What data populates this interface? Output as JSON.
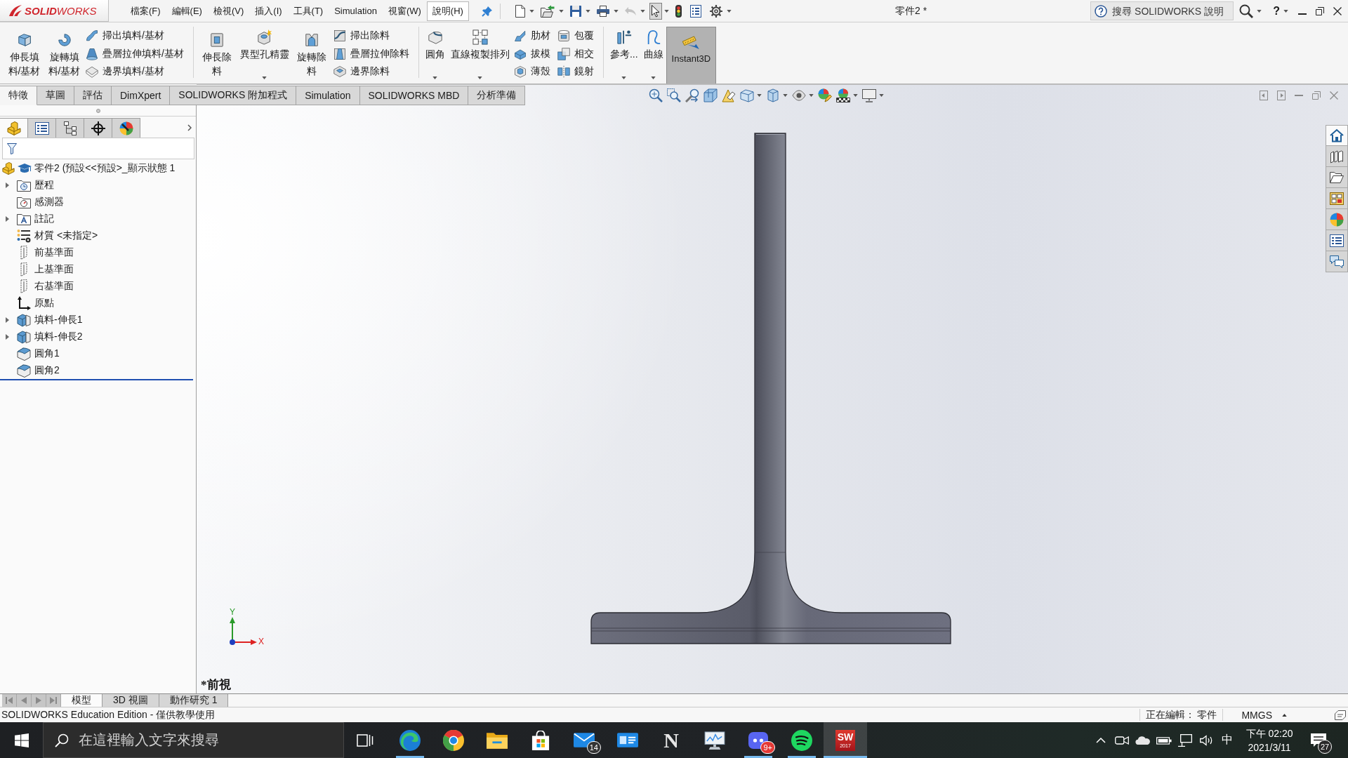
{
  "title_bar": {
    "logo": "**SOLID**WORKS",
    "menu": [
      {
        "label": "檔案(F)",
        "selected": false
      },
      {
        "label": "編輯(E)",
        "selected": false
      },
      {
        "label": "檢視(V)",
        "selected": false
      },
      {
        "label": "插入(I)",
        "selected": false
      },
      {
        "label": "工具(T)",
        "selected": false
      },
      {
        "label": "Simulation",
        "selected": false
      },
      {
        "label": "視窗(W)",
        "selected": false
      },
      {
        "label": "說明(H)",
        "selected": true
      }
    ],
    "quick_access": [
      {
        "kind": "new",
        "dropdown": true,
        "disabled": false,
        "selected": false
      },
      {
        "kind": "open",
        "dropdown": true,
        "disabled": false,
        "selected": false
      },
      {
        "kind": "save",
        "dropdown": true,
        "disabled": false,
        "selected": false
      },
      {
        "kind": "print",
        "dropdown": true,
        "disabled": false,
        "selected": false
      },
      {
        "kind": "undo",
        "dropdown": true,
        "disabled": true,
        "selected": false
      },
      {
        "kind": "select",
        "dropdown": true,
        "disabled": false,
        "selected": true
      },
      {
        "kind": "rebuild",
        "dropdown": false,
        "disabled": false,
        "selected": false
      },
      {
        "kind": "properties",
        "dropdown": false,
        "disabled": false,
        "selected": false
      },
      {
        "kind": "options",
        "dropdown": true,
        "disabled": false,
        "selected": false
      }
    ],
    "document_title": "零件2 *",
    "search": {
      "placeholder": "搜尋 SOLIDWORKS 說明"
    },
    "help": "?"
  },
  "ribbon": {
    "groups": [
      {
        "items": [
          {
            "kind": "large",
            "label": "伸長填料/基材",
            "dropdown": false,
            "pressed": false
          },
          {
            "kind": "large",
            "label": "旋轉填料/基材",
            "dropdown": false,
            "pressed": false
          },
          {
            "kind": "stack",
            "items": [
              {
                "label": "掃出填料/基材"
              },
              {
                "label": "疊層拉伸填料/基材"
              },
              {
                "label": "邊界填料/基材"
              }
            ]
          }
        ]
      },
      {
        "items": [
          {
            "kind": "large",
            "label": "伸長除料",
            "dropdown": false,
            "pressed": false
          },
          {
            "kind": "large",
            "label": "異型孔精靈",
            "dropdown": true,
            "pressed": false
          },
          {
            "kind": "large",
            "label": "旋轉除料",
            "dropdown": false,
            "pressed": false
          },
          {
            "kind": "stack",
            "items": [
              {
                "label": "掃出除料"
              },
              {
                "label": "疊層拉伸除料"
              },
              {
                "label": "邊界除料"
              }
            ]
          }
        ]
      },
      {
        "items": [
          {
            "kind": "large",
            "label": "圓角",
            "dropdown": true,
            "pressed": false
          },
          {
            "kind": "large",
            "label": "直線複製排列",
            "dropdown": true,
            "pressed": false
          },
          {
            "kind": "stack",
            "items": [
              {
                "label": "肋材"
              },
              {
                "label": "拔模"
              },
              {
                "label": "薄殼"
              }
            ]
          },
          {
            "kind": "stack",
            "items": [
              {
                "label": "包覆"
              },
              {
                "label": "相交"
              },
              {
                "label": "鏡射"
              }
            ]
          }
        ]
      },
      {
        "items": [
          {
            "kind": "large",
            "label": "參考...",
            "dropdown": true,
            "pressed": false
          },
          {
            "kind": "large",
            "label": "曲線",
            "dropdown": true,
            "pressed": false
          },
          {
            "kind": "large",
            "label": "Instant3D",
            "dropdown": false,
            "pressed": true
          }
        ]
      }
    ]
  },
  "command_tabs": [
    {
      "label": "特徵",
      "selected": true
    },
    {
      "label": "草圖",
      "selected": false
    },
    {
      "label": "評估",
      "selected": false
    },
    {
      "label": "DimXpert",
      "selected": false
    },
    {
      "label": "SOLIDWORKS 附加程式",
      "selected": false
    },
    {
      "label": "Simulation",
      "selected": false
    },
    {
      "label": "SOLIDWORKS MBD",
      "selected": false
    },
    {
      "label": "分析準備",
      "selected": false
    }
  ],
  "feature_manager": {
    "tabs": [
      {
        "kind": "feature-tree",
        "selected": true
      },
      {
        "kind": "property",
        "selected": false
      },
      {
        "kind": "configuration",
        "selected": false
      },
      {
        "kind": "dimxpert",
        "selected": false
      },
      {
        "kind": "display",
        "selected": false
      }
    ],
    "tree": {
      "label": "零件2 (預設<<預設>_顯示狀態 1",
      "children": [
        {
          "kind": "history",
          "label": "歷程",
          "expandable": true,
          "expanded": false
        },
        {
          "kind": "sensors",
          "label": "感測器",
          "expandable": false
        },
        {
          "kind": "annotations",
          "label": "註記",
          "expandable": true,
          "expanded": false
        },
        {
          "kind": "material",
          "label": "材質 <未指定>",
          "expandable": false
        },
        {
          "kind": "plane",
          "label": "前基準面",
          "expandable": false
        },
        {
          "kind": "plane",
          "label": "上基準面",
          "expandable": false
        },
        {
          "kind": "plane",
          "label": "右基準面",
          "expandable": false
        },
        {
          "kind": "origin",
          "label": "原點",
          "expandable": false
        },
        {
          "kind": "extrude",
          "label": "填料-伸長1",
          "expandable": true,
          "expanded": false
        },
        {
          "kind": "extrude",
          "label": "填料-伸長2",
          "expandable": true,
          "expanded": false
        },
        {
          "kind": "fillet",
          "label": "圓角1",
          "expandable": false
        },
        {
          "kind": "fillet",
          "label": "圓角2",
          "expandable": false
        }
      ]
    }
  },
  "viewport": {
    "view_name": "*前視",
    "triad": {
      "y_label": "Y",
      "x_label": "X"
    },
    "task_pane": [
      {
        "kind": "home",
        "selected": true
      },
      {
        "kind": "library",
        "selected": false
      },
      {
        "kind": "explorer",
        "selected": false
      },
      {
        "kind": "view-palette",
        "selected": false
      },
      {
        "kind": "appearances",
        "selected": false
      },
      {
        "kind": "custom-properties",
        "selected": false
      },
      {
        "kind": "forum",
        "selected": false
      }
    ]
  },
  "bottom_tabs": [
    {
      "label": "模型",
      "selected": true
    },
    {
      "label": "3D 視圖",
      "selected": false
    },
    {
      "label": "動作研究 1",
      "selected": false
    }
  ],
  "status_bar": {
    "message": "SOLIDWORKS Education Edition - 僅供教學使用",
    "editing": "正在編輯： 零件",
    "units": "MMGS"
  },
  "taskbar": {
    "search_placeholder": "在這裡輸入文字來搜尋",
    "apps": [
      {
        "kind": "browser-wave",
        "running": true,
        "selected": false
      },
      {
        "kind": "browser-tricolor",
        "running": false,
        "selected": false
      },
      {
        "kind": "folder",
        "running": false,
        "selected": false
      },
      {
        "kind": "store",
        "running": false,
        "selected": false
      },
      {
        "kind": "mail",
        "badge": "14",
        "running": false,
        "selected": false
      },
      {
        "kind": "contacts",
        "running": false,
        "selected": false
      },
      {
        "kind": "letter",
        "label": "N",
        "running": false,
        "selected": false
      },
      {
        "kind": "monitor",
        "running": false,
        "selected": false
      },
      {
        "kind": "chat",
        "badge": "9+",
        "running": true,
        "selected": false
      },
      {
        "kind": "music",
        "running": true,
        "selected": false
      },
      {
        "kind": "cad",
        "logo": "SW",
        "version": "2017",
        "running": true,
        "selected": true
      }
    ],
    "tray": {
      "ime": "中",
      "time": "下午 02:20",
      "date": "2021/3/11",
      "notifications": "27"
    }
  }
}
